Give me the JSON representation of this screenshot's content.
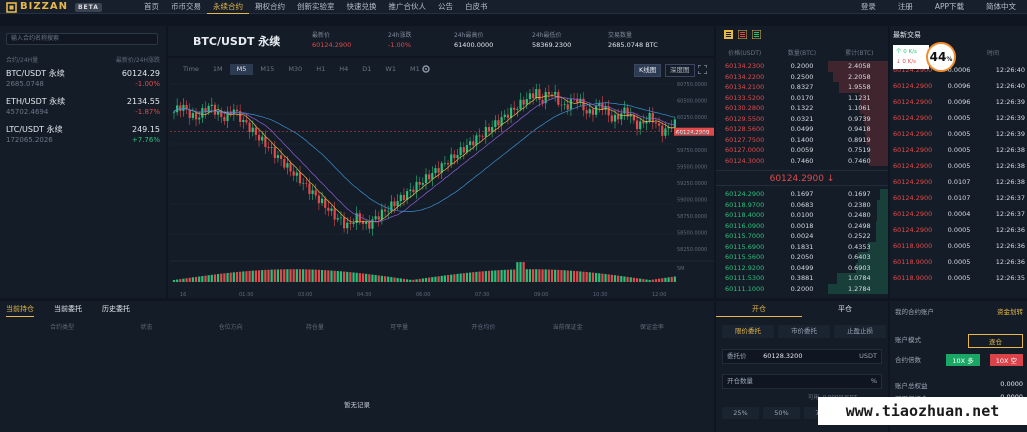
{
  "brand": {
    "name": "BIZZAN",
    "beta": "BETA"
  },
  "nav": [
    "首页",
    "币币交易",
    "永续合约",
    "期权合约",
    "创新实验室",
    "快速兑换",
    "推广合伙人",
    "公告",
    "白皮书"
  ],
  "nav_active": 2,
  "top_right": [
    "登录",
    "注册",
    "APP下载",
    "简体中文"
  ],
  "market": {
    "search_placeholder": "输入合约名称搜索",
    "head_left": "合约/24H量",
    "head_right": "最新价/24H涨跌",
    "rows": [
      {
        "name": "BTC/USDT 永续",
        "price": "60124.29",
        "vol": "2685.0748",
        "change": "-1.00%",
        "dir": "down"
      },
      {
        "name": "ETH/USDT 永续",
        "price": "2134.55",
        "vol": "45702.4694",
        "change": "-1.87%",
        "dir": "down"
      },
      {
        "name": "LTC/USDT 永续",
        "price": "249.15",
        "vol": "172065.2026",
        "change": "+7.76%",
        "dir": "up"
      }
    ]
  },
  "ticker": {
    "symbol": "BTC/USDT 永续",
    "stats": [
      {
        "label": "最新价",
        "value": "60124.2900",
        "color": "red"
      },
      {
        "label": "24h涨跌",
        "value": "-1.00%",
        "color": "red"
      },
      {
        "label": "24h最高价",
        "value": "61400.0000",
        "color": "white"
      },
      {
        "label": "24h最低价",
        "value": "58369.2300",
        "color": "white"
      },
      {
        "label": "交易数量",
        "value": "2685.0748 BTC",
        "color": "white"
      }
    ]
  },
  "chart": {
    "timeframes": [
      "Time",
      "1M",
      "M5",
      "M15",
      "M30",
      "H1",
      "H4",
      "D1",
      "W1",
      "M1"
    ],
    "active_tf": 2,
    "view_k": "K线图",
    "view_depth": "深度图",
    "price_labels": [
      "60750.0000",
      "60500.0000",
      "60250.0000",
      "60000.0000",
      "59750.0000",
      "59500.0000",
      "59250.0000",
      "59000.0000",
      "58750.0000",
      "58500.0000",
      "58250.0000"
    ],
    "last_price_tag": "60124.2900",
    "time_labels": [
      "16",
      "01:30",
      "03:00",
      "04:30",
      "06:00",
      "07:30",
      "09:00",
      "10:30",
      "12:00"
    ],
    "vol_label": "5M"
  },
  "orderbook": {
    "icons": [
      "book-both-icon",
      "book-sell-icon",
      "book-buy-icon"
    ],
    "headers": [
      "价格(USDT)",
      "数量(BTC)",
      "累计(BTC)"
    ],
    "asks": [
      [
        "60134.2300",
        "0.2000",
        "2.4058"
      ],
      [
        "60134.2200",
        "0.2500",
        "2.2058"
      ],
      [
        "60134.2100",
        "0.8327",
        "1.9558"
      ],
      [
        "60133.5200",
        "0.0170",
        "1.1231"
      ],
      [
        "60130.2800",
        "0.1322",
        "1.1061"
      ],
      [
        "60129.5500",
        "0.0321",
        "0.9739"
      ],
      [
        "60128.5600",
        "0.0499",
        "0.9418"
      ],
      [
        "60127.7500",
        "0.1400",
        "0.8919"
      ],
      [
        "60127.0000",
        "0.0059",
        "0.7519"
      ],
      [
        "60124.3000",
        "0.7460",
        "0.7460"
      ]
    ],
    "ask_depth": [
      1.0,
      0.92,
      0.81,
      0.47,
      0.46,
      0.4,
      0.39,
      0.37,
      0.31,
      0.31
    ],
    "mid": "60124.2900 ↓",
    "bids": [
      [
        "60124.2900",
        "0.1697",
        "0.1697"
      ],
      [
        "60118.9700",
        "0.0683",
        "0.2380"
      ],
      [
        "60118.4000",
        "0.0100",
        "0.2480"
      ],
      [
        "60116.0900",
        "0.0018",
        "0.2498"
      ],
      [
        "60115.7000",
        "0.0024",
        "0.2522"
      ],
      [
        "60115.6900",
        "0.1831",
        "0.4353"
      ],
      [
        "60115.5600",
        "0.2050",
        "0.6403"
      ],
      [
        "60112.9200",
        "0.0499",
        "0.6903"
      ],
      [
        "60111.5300",
        "0.3881",
        "1.0784"
      ],
      [
        "60111.1000",
        "0.2000",
        "1.2784"
      ]
    ],
    "bid_depth": [
      0.13,
      0.19,
      0.19,
      0.2,
      0.2,
      0.34,
      0.5,
      0.54,
      0.84,
      1.0
    ]
  },
  "trades": {
    "title": "最新交易",
    "headers": [
      "价格",
      "数量",
      "时间"
    ],
    "popup": {
      "up": "个 0 K/s",
      "down": "↓ 0 K/s",
      "percent": "44",
      "unit": "%"
    },
    "rows": [
      [
        "60124.2900",
        "0.0006",
        "12:26:40"
      ],
      [
        "60124.2900",
        "0.0096",
        "12:26:40"
      ],
      [
        "60124.2900",
        "0.0096",
        "12:26:39"
      ],
      [
        "60124.2900",
        "0.0005",
        "12:26:39"
      ],
      [
        "60124.2900",
        "0.0005",
        "12:26:39"
      ],
      [
        "60124.2900",
        "0.0005",
        "12:26:38"
      ],
      [
        "60124.2900",
        "0.0005",
        "12:26:38"
      ],
      [
        "60124.2900",
        "0.0107",
        "12:26:38"
      ],
      [
        "60124.2900",
        "0.0107",
        "12:26:37"
      ],
      [
        "60124.2900",
        "0.0004",
        "12:26:37"
      ],
      [
        "60124.2900",
        "0.0005",
        "12:26:36"
      ],
      [
        "60118.9000",
        "0.0005",
        "12:26:36"
      ],
      [
        "60118.9000",
        "0.0005",
        "12:26:36"
      ],
      [
        "60118.9000",
        "0.0005",
        "12:26:35"
      ]
    ],
    "row_color": [
      "red",
      "red",
      "red",
      "red",
      "red",
      "red",
      "red",
      "red",
      "red",
      "red",
      "red",
      "red",
      "red",
      "red"
    ]
  },
  "positions": {
    "tabs": [
      "当前持仓",
      "当前委托",
      "历史委托"
    ],
    "columns": [
      "合约类型",
      "状态",
      "仓位方向",
      "持仓量",
      "可平量",
      "开仓均价",
      "当前保证金",
      "保证金率"
    ],
    "empty": "暂无记录"
  },
  "order_form": {
    "tabs": [
      "开仓",
      "平仓"
    ],
    "sub_tabs": [
      "限价委托",
      "市价委托",
      "止盈止损"
    ],
    "price_label": "委托价",
    "price_value": "60128.3200",
    "price_unit": "USDT",
    "amount_label": "开仓数量",
    "amount_unit": "%",
    "hint": "可用: 0.0000USDT",
    "percents": [
      "25%",
      "50%",
      "75%",
      "100%"
    ]
  },
  "account": {
    "title": "我的合约账户",
    "transfer": "资金划转",
    "mode_label": "账户模式",
    "mode_value": "逐仓",
    "lev_label": "合约倍数",
    "lev_long": "10X 多",
    "lev_short": "10X 空",
    "rows": [
      {
        "label": "账户总权益",
        "value": "0.0000"
      },
      {
        "label": "可用保证金",
        "value": "0.0000"
      },
      {
        "label": "冻结保证金",
        "value": "0.0000"
      }
    ]
  },
  "watermark": "www.tiaozhuan.net"
}
